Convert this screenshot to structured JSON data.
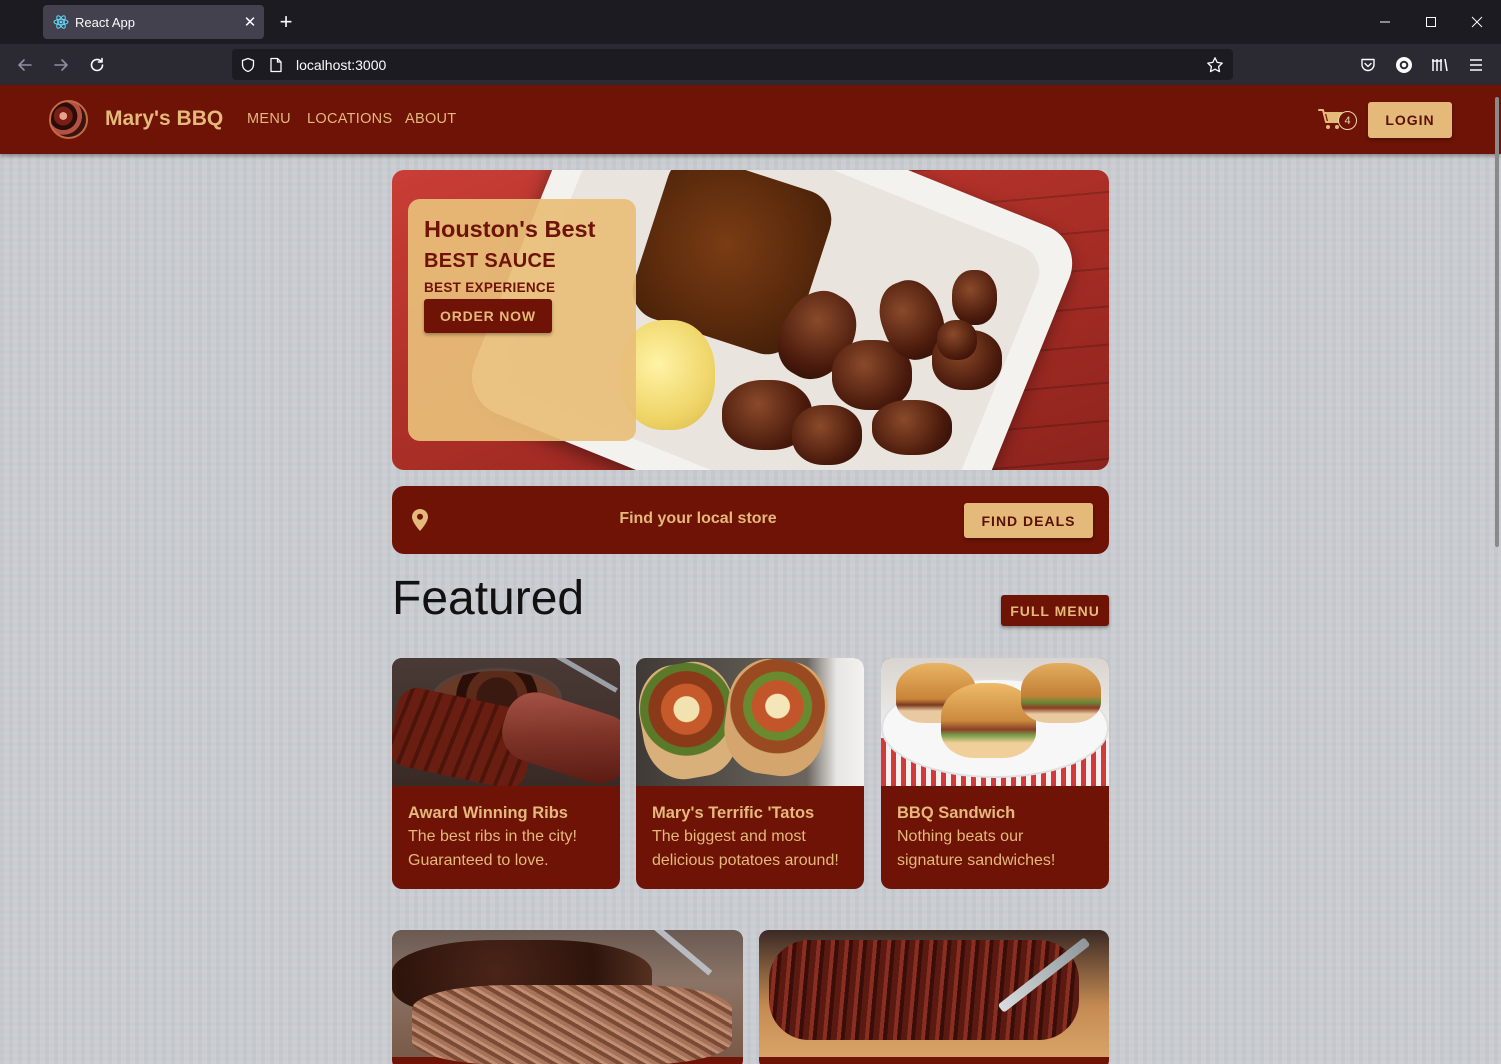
{
  "browser": {
    "tab_title": "React App",
    "url": "localhost:3000"
  },
  "site": {
    "brand": "Mary's BBQ",
    "nav": [
      "MENU",
      "LOCATIONS",
      "ABOUT"
    ],
    "cart_count": "4",
    "login_label": "LOGIN"
  },
  "hero": {
    "headline": "Houston's Best",
    "line2": "BEST SAUCE",
    "line3": "BEST EXPERIENCE",
    "cta": "ORDER NOW"
  },
  "store": {
    "text": "Find your local store",
    "button": "FIND DEALS"
  },
  "featured": {
    "heading": "Featured",
    "full_menu": "FULL MENU",
    "items": [
      {
        "title": "Award Winning Ribs",
        "desc": "The best ribs in the city! Guaranteed to love."
      },
      {
        "title": "Mary's Terrific 'Tatos",
        "desc": "The biggest and most delicious potatoes around!"
      },
      {
        "title": "BBQ Sandwich",
        "desc": "Nothing beats our signature sandwiches!"
      }
    ]
  },
  "colors": {
    "maroon": "#6e1306",
    "tan": "#e5b97a",
    "page_bg": "#c9ccd1"
  },
  "icons": {
    "tab_favicon": "react-icon",
    "back": "back-arrow-icon",
    "forward": "forward-arrow-icon",
    "reload": "reload-icon",
    "shield": "shield-icon",
    "page": "page-icon",
    "bookmark": "star-icon",
    "pocket": "pocket-icon",
    "account": "account-icon",
    "library": "library-icon",
    "menu": "hamburger-icon",
    "cart": "cart-icon",
    "location": "location-pin-icon"
  }
}
